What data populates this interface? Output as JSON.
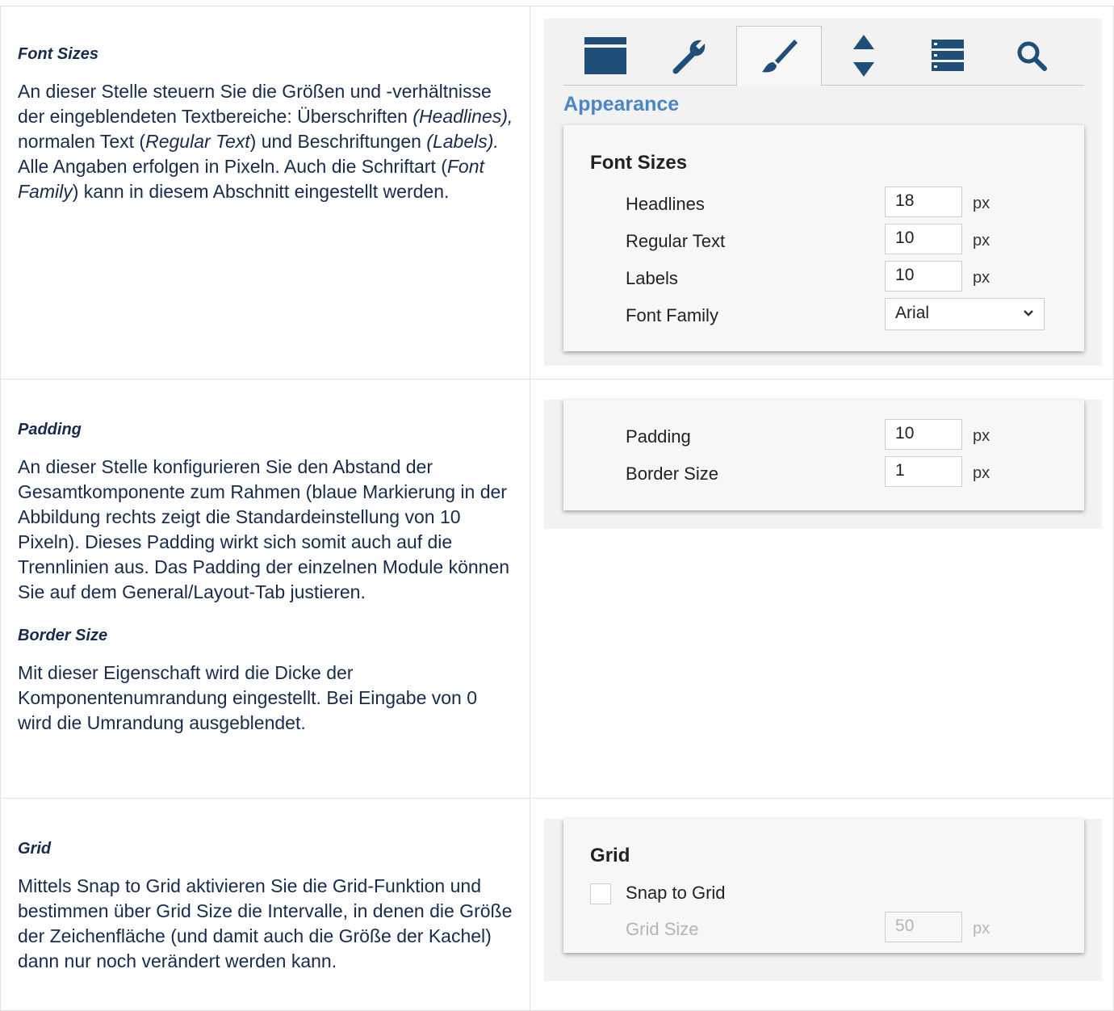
{
  "section1": {
    "term": "Font Sizes",
    "p_a": "An dieser Stelle steuern Sie die Größen und -verhältnisse der eingeblendeten Textbereiche: Überschriften ",
    "p_i1": "(Headlines),",
    "p_b": " normalen Text (",
    "p_i2": "Regular Text",
    "p_c": ") und Beschriftungen ",
    "p_i3": "(Labels).",
    "p_d": " Alle Angaben erfolgen in Pixeln. Auch die Schriftart (",
    "p_i4": "Font Family",
    "p_e": ") kann in diesem Abschnitt eingestellt werden."
  },
  "section2": {
    "term_padding": "Padding",
    "p_padding": "An dieser Stelle konfigurieren Sie den Abstand der Gesamtkomponente zum Rahmen (blaue Markierung in der Abbildung rechts zeigt die Standardeinstellung von 10 Pixeln). Dieses Padding wirkt sich somit auch auf die Trennlinien aus. Das Padding der einzelnen Module können Sie auf dem General/Layout-Tab justieren.",
    "term_border": "Border Size",
    "p_border": "Mit dieser Eigenschaft wird die Dicke der Komponentenumrandung eingestellt. Bei Eingabe von 0 wird die Umrandung ausgeblendet."
  },
  "section3": {
    "term": "Grid",
    "p": "Mittels Snap to Grid aktivieren Sie die Grid-Funktion und bestimmen über Grid Size die Intervalle, in denen die Größe der Zeichenfläche (und damit auch die Größe der Kachel) dann nur noch verändert werden kann."
  },
  "panel": {
    "tabs": [
      "layout-icon",
      "wrench-icon",
      "brush-icon",
      "sort-icon",
      "list-icon",
      "search-icon"
    ],
    "active_tab": "brush-icon",
    "accent": "#4a86c5",
    "section_title": "Appearance",
    "font_sizes": {
      "title": "Font Sizes",
      "headlines_label": "Headlines",
      "headlines_value": "18",
      "regular_label": "Regular Text",
      "regular_value": "10",
      "labels_label": "Labels",
      "labels_value": "10",
      "family_label": "Font Family",
      "family_value": "Arial",
      "unit": "px"
    },
    "padding": {
      "padding_label": "Padding",
      "padding_value": "10",
      "border_label": "Border Size",
      "border_value": "1",
      "unit": "px"
    },
    "grid": {
      "title": "Grid",
      "snap_label": "Snap to Grid",
      "snap_checked": false,
      "size_label": "Grid Size",
      "size_value": "50",
      "unit": "px"
    }
  }
}
